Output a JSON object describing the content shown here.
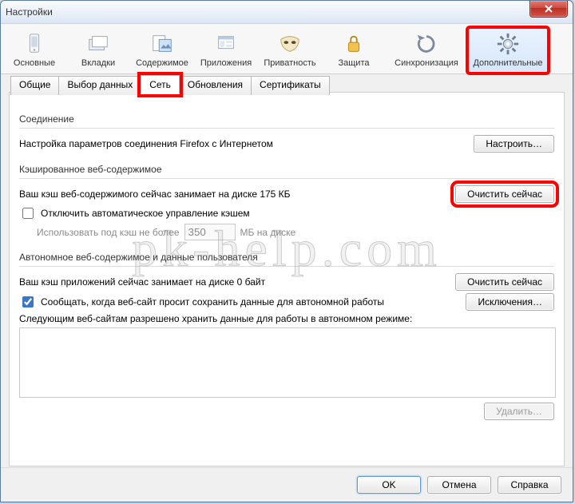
{
  "window": {
    "title": "Настройки"
  },
  "categories": {
    "main": {
      "label": "Основные"
    },
    "tabs": {
      "label": "Вкладки"
    },
    "content": {
      "label": "Содержимое"
    },
    "apps": {
      "label": "Приложения"
    },
    "privacy": {
      "label": "Приватность"
    },
    "security": {
      "label": "Защита"
    },
    "sync": {
      "label": "Синхронизация"
    },
    "advanced": {
      "label": "Дополнительные"
    }
  },
  "subtabs": {
    "general": "Общие",
    "data": "Выбор данных",
    "network": "Сеть",
    "updates": "Обновления",
    "certs": "Сертификаты"
  },
  "connection": {
    "title": "Соединение",
    "desc": "Настройка параметров соединения Firefox с Интернетом",
    "configure_btn": "Настроить…"
  },
  "cache": {
    "title": "Кэшированное веб-содержимое",
    "size_line": "Ваш кэш веб-содержимого сейчас занимает на диске 175 КБ",
    "clear_btn": "Очистить сейчас",
    "disable_auto": "Отключить автоматическое управление кэшем",
    "use_upto_prefix": "Использовать под кэш не более",
    "use_upto_value": "350",
    "use_upto_suffix": "МБ на диске"
  },
  "offline": {
    "title": "Автономное веб-содержимое и данные пользователя",
    "size_line": "Ваш кэш приложений сейчас занимает на диске 0 байт",
    "clear_btn": "Очистить сейчас",
    "notify": "Сообщать, когда веб-сайт просит сохранить данные для автономной работы",
    "exceptions_btn": "Исключения…",
    "allowed_label": "Следующим веб-сайтам разрешено хранить данные для работы в автономном режиме:",
    "remove_btn": "Удалить…"
  },
  "footer": {
    "ok": "OK",
    "cancel": "Отмена",
    "help": "Справка"
  },
  "watermark": "pk-help.com"
}
